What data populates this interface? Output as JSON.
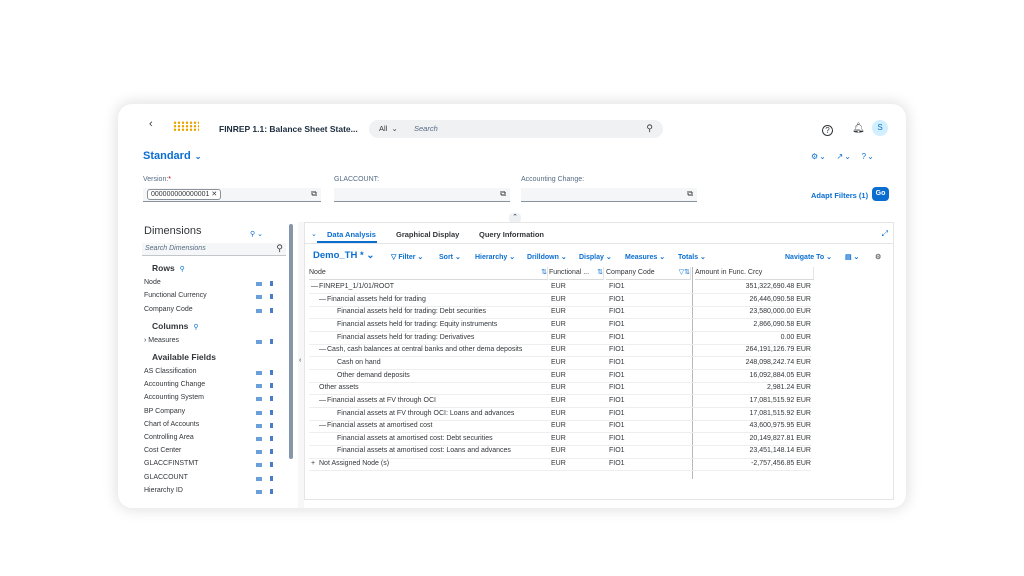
{
  "shell": {
    "title": "FINREP 1.1: Balance Sheet State...",
    "search_scope": "All",
    "search_placeholder": "Search",
    "avatar_initial": "S"
  },
  "variant": {
    "name": "Standard"
  },
  "filters": [
    {
      "label": "Version:",
      "required": true,
      "token": "000000000000001"
    },
    {
      "label": "GLACCOUNT:",
      "required": false,
      "token": ""
    },
    {
      "label": "Accounting Change:",
      "required": false,
      "token": ""
    }
  ],
  "filterbar": {
    "adapt": "Adapt Filters (1)",
    "go": "Go"
  },
  "dimensions": {
    "title": "Dimensions",
    "search_placeholder": "Search Dimensions",
    "rows_label": "Rows",
    "rows": [
      "Node",
      "Functional Currency",
      "Company Code"
    ],
    "columns_label": "Columns",
    "columns": [
      "Measures"
    ],
    "available_label": "Available Fields",
    "available": [
      "AS Classification",
      "Accounting Change",
      "Accounting System",
      "BP Company",
      "Chart of Accounts",
      "Controlling Area",
      "Cost Center",
      "GLACCFINSTMT",
      "GLACCOUNT",
      "Hierarchy ID"
    ]
  },
  "tabs": [
    "Data Analysis",
    "Graphical Display",
    "Query Information"
  ],
  "toolbar": {
    "query": "Demo_TH *",
    "items": [
      "Filter",
      "Sort",
      "Hierarchy",
      "Drilldown",
      "Display",
      "Measures",
      "Totals"
    ],
    "navigate": "Navigate To"
  },
  "table": {
    "headers": [
      "Node",
      "Functional ...",
      "Company Code",
      "Amount in Func. Crcy"
    ],
    "rows": [
      {
        "node": "FINREP1_1/1/01/ROOT",
        "lvl": 0,
        "exp": "—",
        "cur": "EUR",
        "cc": "FIO1",
        "amt": "351,322,690.48 EUR"
      },
      {
        "node": "Financial assets held for trading",
        "lvl": 1,
        "exp": "—",
        "cur": "EUR",
        "cc": "FIO1",
        "amt": "26,446,090.58 EUR"
      },
      {
        "node": "Financial assets held for trading: Debt securities",
        "lvl": 2,
        "exp": "",
        "cur": "EUR",
        "cc": "FIO1",
        "amt": "23,580,000.00 EUR"
      },
      {
        "node": "Financial assets held for trading: Equity instruments",
        "lvl": 2,
        "exp": "",
        "cur": "EUR",
        "cc": "FIO1",
        "amt": "2,866,090.58 EUR"
      },
      {
        "node": "Financial assets held for trading: Derivatives",
        "lvl": 2,
        "exp": "",
        "cur": "EUR",
        "cc": "FIO1",
        "amt": "0.00 EUR"
      },
      {
        "node": "Cash, cash balances at central banks and other dema deposits",
        "lvl": 1,
        "exp": "—",
        "cur": "EUR",
        "cc": "FIO1",
        "amt": "264,191,126.79 EUR"
      },
      {
        "node": "Cash on hand",
        "lvl": 2,
        "exp": "",
        "cur": "EUR",
        "cc": "FIO1",
        "amt": "248,098,242.74 EUR"
      },
      {
        "node": "Other demand deposits",
        "lvl": 2,
        "exp": "",
        "cur": "EUR",
        "cc": "FIO1",
        "amt": "16,092,884.05 EUR"
      },
      {
        "node": "Other assets",
        "lvl": 1,
        "exp": "",
        "cur": "EUR",
        "cc": "FIO1",
        "amt": "2,981.24 EUR"
      },
      {
        "node": "Financial assets at FV through OCI",
        "lvl": 1,
        "exp": "—",
        "cur": "EUR",
        "cc": "FIO1",
        "amt": "17,081,515.92 EUR"
      },
      {
        "node": "Financial assets at FV through OCI: Loans and advances",
        "lvl": 2,
        "exp": "",
        "cur": "EUR",
        "cc": "FIO1",
        "amt": "17,081,515.92 EUR"
      },
      {
        "node": "Financial assets at amortised cost",
        "lvl": 1,
        "exp": "—",
        "cur": "EUR",
        "cc": "FIO1",
        "amt": "43,600,975.95 EUR"
      },
      {
        "node": "Financial assets at amortised cost: Debt securities",
        "lvl": 2,
        "exp": "",
        "cur": "EUR",
        "cc": "FIO1",
        "amt": "20,149,827.81 EUR"
      },
      {
        "node": "Financial assets at amortised cost: Loans and advances",
        "lvl": 2,
        "exp": "",
        "cur": "EUR",
        "cc": "FIO1",
        "amt": "23,451,148.14 EUR"
      },
      {
        "node": "Not Assigned Node (s)",
        "lvl": 0,
        "exp": "+",
        "cur": "EUR",
        "cc": "FIO1",
        "amt": "-2,757,456.85 EUR"
      }
    ]
  }
}
